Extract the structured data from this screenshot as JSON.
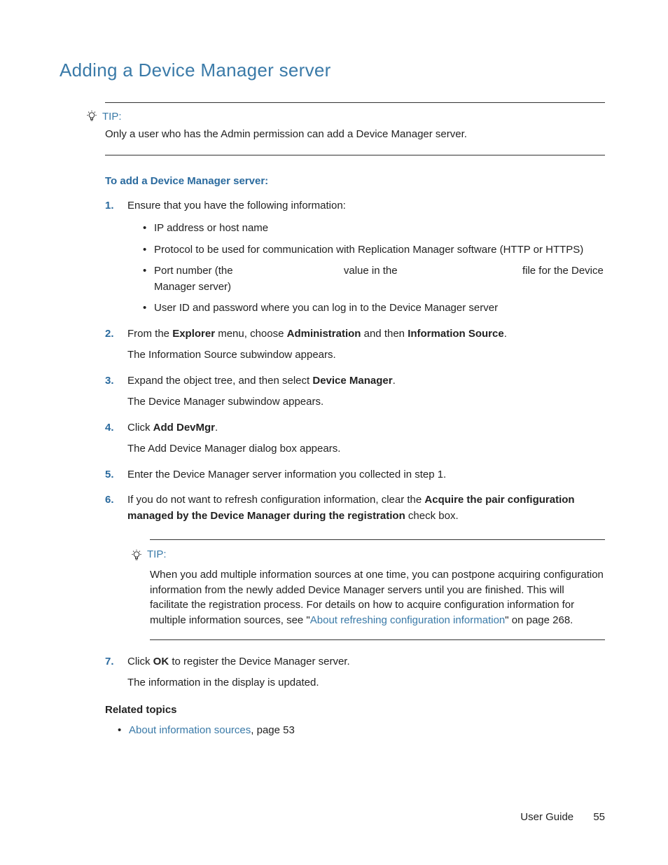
{
  "title": "Adding a Device Manager server",
  "tip1": {
    "label": "TIP:",
    "body": "Only a user who has the Admin permission can add a Device Manager server."
  },
  "subheading": "To add a Device Manager server:",
  "steps": {
    "s1": {
      "text": "Ensure that you have the following information:",
      "bullets": {
        "b1": "IP address or host name",
        "b2": "Protocol to be used for communication with Replication Manager software (HTTP or HTTPS)",
        "b3a": "Port number (the ",
        "b3b": " value in the ",
        "b3c": " file for the Device Manager server)",
        "b4": "User ID and password where you can log in to the Device Manager server"
      }
    },
    "s2": {
      "pre": "From the ",
      "bold1": "Explorer",
      "mid1": " menu, choose ",
      "bold2": "Administration",
      "mid2": " and then ",
      "bold3": "Information Source",
      "post": ".",
      "follow": "The Information Source subwindow appears."
    },
    "s3": {
      "pre": "Expand the object tree, and then select ",
      "bold1": "Device Manager",
      "post": ".",
      "follow": "The Device Manager subwindow appears."
    },
    "s4": {
      "pre": "Click ",
      "bold1": "Add DevMgr",
      "post": ".",
      "follow": "The Add Device Manager dialog box appears."
    },
    "s5": {
      "text": "Enter the Device Manager server information you collected in step 1."
    },
    "s6": {
      "pre": "If you do not want to refresh configuration information, clear the ",
      "bold1": "Acquire the pair configuration managed by the Device Manager during the registration",
      "post": " check box."
    },
    "s7": {
      "pre": "Click ",
      "bold1": "OK",
      "post": " to register the Device Manager server.",
      "follow": "The information in the display is updated."
    }
  },
  "tip2": {
    "label": "TIP:",
    "body_pre": "When you add multiple information sources at one time, you can postpone acquiring configuration information from the newly added Device Manager servers until you are finished. This will facilitate the registration process. For details on how to acquire configuration information for multiple information sources, see \"",
    "link": "About refreshing configuration information",
    "body_post": "\" on page 268."
  },
  "related": {
    "heading": "Related topics",
    "item1_link": "About information sources",
    "item1_post": ", page 53"
  },
  "footer": {
    "label": "User Guide",
    "page": "55"
  }
}
